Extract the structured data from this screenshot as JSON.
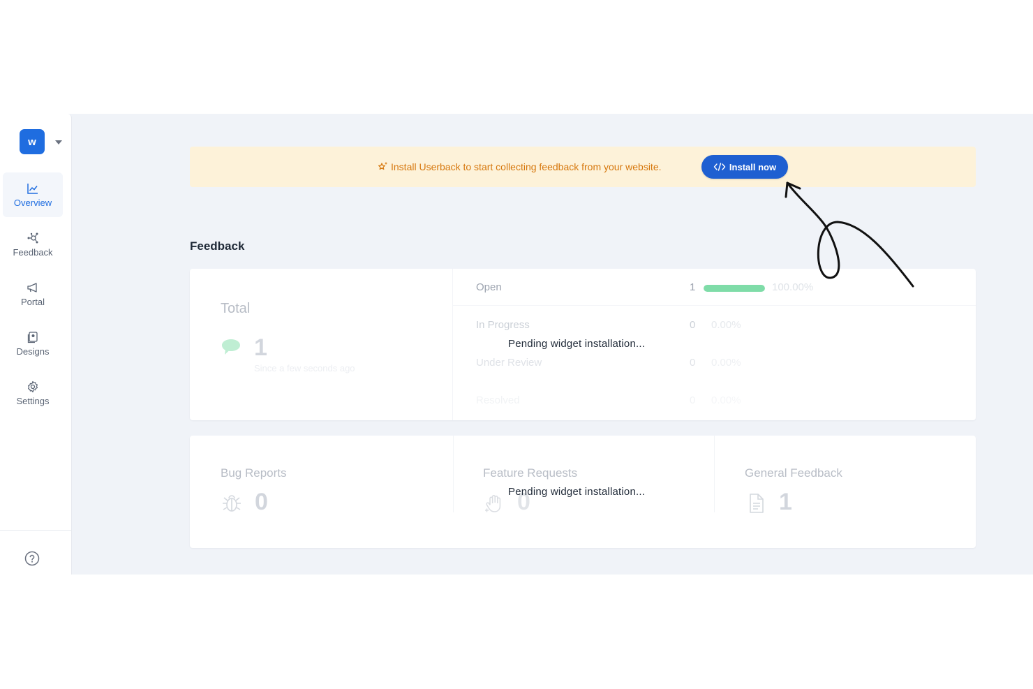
{
  "workspace": {
    "initial": "w"
  },
  "sidebar": {
    "items": [
      {
        "label": "Overview",
        "icon": "chart-line-icon",
        "active": true
      },
      {
        "label": "Feedback",
        "icon": "nodes-icon",
        "active": false
      },
      {
        "label": "Portal",
        "icon": "megaphone-icon",
        "active": false
      },
      {
        "label": "Designs",
        "icon": "designs-icon",
        "active": false
      },
      {
        "label": "Settings",
        "icon": "gear-icon",
        "active": false
      }
    ],
    "help_icon": "help-circle-icon"
  },
  "banner": {
    "text": "Install Userback to start collecting feedback from your website.",
    "button_label": "Install now",
    "text_color": "#d6770c",
    "background": "#fdf2d9",
    "button_color": "#1e5fd1"
  },
  "feedback": {
    "title": "Feedback",
    "total": {
      "label": "Total",
      "value": "1",
      "since": "Since a few seconds ago"
    },
    "statuses": [
      {
        "label": "Open",
        "count": "1",
        "percent_text": "100.00%",
        "fraction": 1.0
      },
      {
        "label": "In Progress",
        "count": "0",
        "percent_text": "0.00%",
        "fraction": 0
      },
      {
        "label": "Under Review",
        "count": "0",
        "percent_text": "0.00%",
        "fraction": 0
      },
      {
        "label": "Resolved",
        "count": "0",
        "percent_text": "0.00%",
        "fraction": 0
      }
    ],
    "pending_text": "Pending widget installation...",
    "types": [
      {
        "label": "Bug Reports",
        "value": "0",
        "icon": "bug-icon"
      },
      {
        "label": "Feature Requests",
        "value": "0",
        "icon": "hand-icon"
      },
      {
        "label": "General Feedback",
        "value": "1",
        "icon": "document-icon"
      }
    ],
    "pending_text_2": "Pending widget installation..."
  },
  "colors": {
    "accent": "#1f6de0",
    "progress": "#7fdca8"
  }
}
